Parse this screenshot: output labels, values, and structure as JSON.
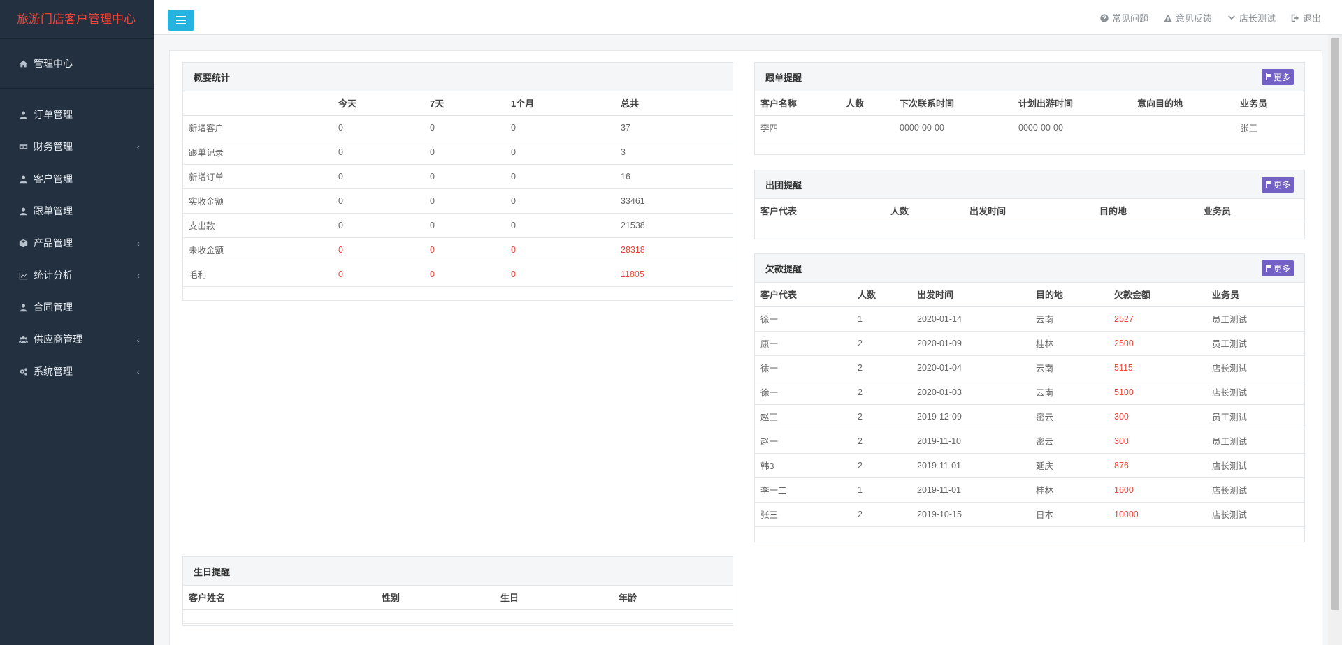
{
  "app": {
    "title": "旅游门店客户管理中心"
  },
  "topbar": {
    "links": [
      {
        "label": "常见问题",
        "icon": "question-circle-icon"
      },
      {
        "label": "意见反馈",
        "icon": "warning-icon"
      },
      {
        "label": "店长测试",
        "icon": "chevron-down-icon"
      },
      {
        "label": "退出",
        "icon": "sign-out-icon"
      }
    ]
  },
  "sidebar": {
    "home": {
      "label": "管理中心",
      "icon": "home-icon"
    },
    "items": [
      {
        "label": "订单管理",
        "icon": "user-icon",
        "submenu": false
      },
      {
        "label": "财务管理",
        "icon": "money-icon",
        "submenu": true
      },
      {
        "label": "客户管理",
        "icon": "user-icon",
        "submenu": false
      },
      {
        "label": "跟单管理",
        "icon": "user-icon",
        "submenu": false
      },
      {
        "label": "产品管理",
        "icon": "cube-icon",
        "submenu": true
      },
      {
        "label": "统计分析",
        "icon": "line-chart-icon",
        "submenu": true
      },
      {
        "label": "合同管理",
        "icon": "user-icon",
        "submenu": false
      },
      {
        "label": "供应商管理",
        "icon": "users-icon",
        "submenu": true
      },
      {
        "label": "系统管理",
        "icon": "cogs-icon",
        "submenu": true
      }
    ]
  },
  "overview": {
    "title": "概要统计",
    "headers": [
      "",
      "今天",
      "7天",
      "1个月",
      "总共"
    ],
    "rows": [
      {
        "cells": [
          "新增客户",
          "0",
          "0",
          "0",
          "37"
        ],
        "highlight": false
      },
      {
        "cells": [
          "跟单记录",
          "0",
          "0",
          "0",
          "3"
        ],
        "highlight": false
      },
      {
        "cells": [
          "新增订单",
          "0",
          "0",
          "0",
          "16"
        ],
        "highlight": false
      },
      {
        "cells": [
          "实收金额",
          "0",
          "0",
          "0",
          "33461"
        ],
        "highlight": false
      },
      {
        "cells": [
          "支出款",
          "0",
          "0",
          "0",
          "21538"
        ],
        "highlight": false
      },
      {
        "cells": [
          "未收金额",
          "0",
          "0",
          "0",
          "28318"
        ],
        "highlight": true
      },
      {
        "cells": [
          "毛利",
          "0",
          "0",
          "0",
          "11805"
        ],
        "highlight": true
      }
    ]
  },
  "followup": {
    "title": "跟单提醒",
    "more_label": "更多",
    "headers": [
      "客户名称",
      "人数",
      "下次联系时间",
      "计划出游时间",
      "意向目的地",
      "业务员"
    ],
    "rows": [
      [
        "李四",
        "",
        "0000-00-00",
        "0000-00-00",
        "",
        "张三"
      ]
    ]
  },
  "departure": {
    "title": "出团提醒",
    "more_label": "更多",
    "headers": [
      "客户代表",
      "人数",
      "出发时间",
      "目的地",
      "业务员"
    ],
    "rows": []
  },
  "debt": {
    "title": "欠款提醒",
    "more_label": "更多",
    "headers": [
      "客户代表",
      "人数",
      "出发时间",
      "目的地",
      "欠款金额",
      "业务员"
    ],
    "rows": [
      [
        "徐一",
        "1",
        "2020-01-14",
        "云南",
        "2527",
        "员工测试"
      ],
      [
        "康一",
        "2",
        "2020-01-09",
        "桂林",
        "2500",
        "员工测试"
      ],
      [
        "徐一",
        "2",
        "2020-01-04",
        "云南",
        "5115",
        "店长测试"
      ],
      [
        "徐一",
        "2",
        "2020-01-03",
        "云南",
        "5100",
        "店长测试"
      ],
      [
        "赵三",
        "2",
        "2019-12-09",
        "密云",
        "300",
        "员工测试"
      ],
      [
        "赵一",
        "2",
        "2019-11-10",
        "密云",
        "300",
        "员工测试"
      ],
      [
        "韩3",
        "2",
        "2019-11-01",
        "延庆",
        "876",
        "店长测试"
      ],
      [
        "李一二",
        "1",
        "2019-11-01",
        "桂林",
        "1600",
        "店长测试"
      ],
      [
        "张三",
        "2",
        "2019-10-15",
        "日本",
        "10000",
        "店长测试"
      ]
    ]
  },
  "birthday": {
    "title": "生日提醒",
    "headers": [
      "客户姓名",
      "性别",
      "生日",
      "年龄"
    ],
    "rows": []
  }
}
